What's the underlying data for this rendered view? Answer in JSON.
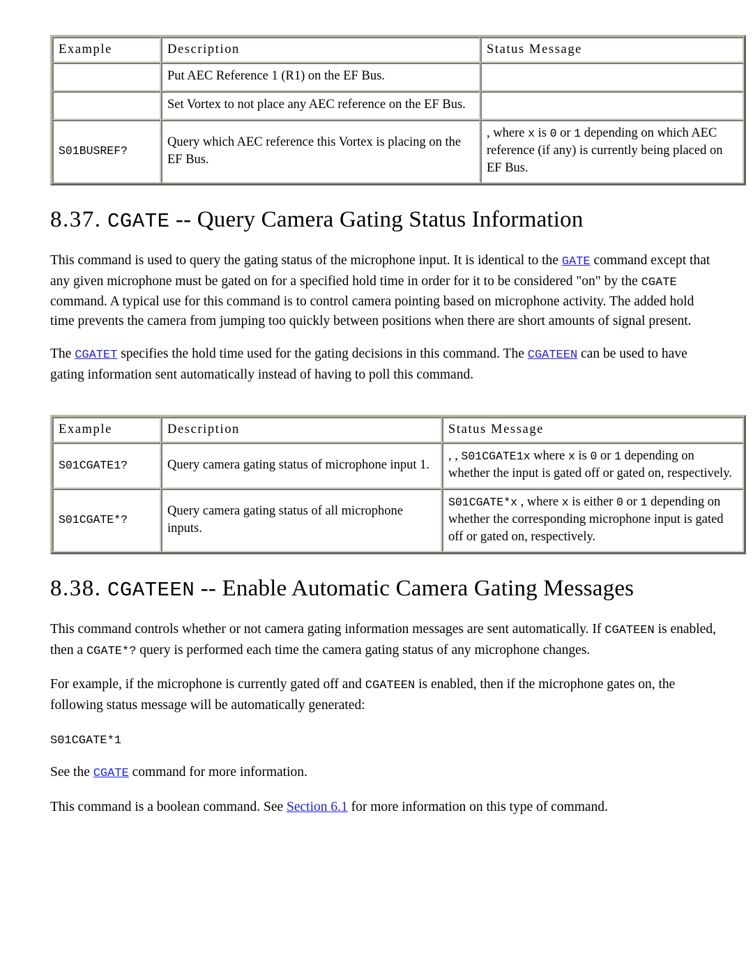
{
  "table_busref": {
    "headers": [
      "Example",
      "Description",
      "Status Message"
    ],
    "rows": [
      {
        "example": "",
        "description": "Put AEC Reference 1 (R1) on the EF Bus.",
        "status": ""
      },
      {
        "example": "",
        "description": "Set Vortex to not place any AEC reference on the EF Bus.",
        "status": ""
      },
      {
        "example": "S01BUSREF?",
        "description": "Query which AEC reference this Vortex is placing on the EF Bus.",
        "status_parts": {
          "lead": ", where ",
          "x": "x",
          "mid1": " is ",
          "zero": "0",
          "mid2": " or ",
          "one": "1",
          "tail": " depending on which AEC reference (if any) is currently being placed on EF Bus."
        }
      }
    ]
  },
  "section_cgate": {
    "number": "8.37.",
    "command": "CGATE",
    "dashes": "--",
    "title": "Query Camera Gating Status Information",
    "paragraph_1": {
      "part_1": "This command is used to query the gating status of the microphone input. It is identical to the ",
      "link_gate": "GATE",
      "part_2": " command except that any given microphone must be gated on for a specified hold time in order for it to be considered \"on\" by the ",
      "mono_cgate": "CGATE",
      "part_3": " command. A typical use for this command is to control camera pointing based on microphone activity. The added hold time prevents the camera from jumping too quickly between positions when there are short amounts of signal present."
    },
    "paragraph_2": {
      "part_1": "The ",
      "link_cgatet": "CGATET",
      "part_2": " specifies the hold time used for the gating decisions in this command. The ",
      "link_cgateen": "CGATEEN",
      "part_3": " can be used to have gating information sent automatically instead of having to poll this command."
    }
  },
  "table_cgate": {
    "headers": [
      "Example",
      "Description",
      "Status Message"
    ],
    "rows": [
      {
        "example": "S01CGATE1?",
        "description": "Query camera gating status of microphone input 1.",
        "status_parts": {
          "lead": ", , ",
          "code": "S01CGATE1x",
          "mid1": " where ",
          "x": "x",
          "mid2": " is ",
          "zero": "0",
          "mid3": " or ",
          "one": "1",
          "tail": " depending on whether the input is gated off or gated on, respectively."
        }
      },
      {
        "example": "S01CGATE*?",
        "description": "Query camera gating status of all microphone inputs.",
        "status_parts": {
          "lead": "",
          "code": "S01CGATE*x",
          "mid1": " , where ",
          "x": "x",
          "mid2": " is either ",
          "zero": "0",
          "mid3": " or ",
          "one": "1",
          "tail": " depending on whether the corresponding microphone input is gated off or gated on, respectively."
        }
      }
    ]
  },
  "section_cgateen": {
    "number": "8.38.",
    "command": "CGATEEN",
    "dashes": "--",
    "title": "Enable Automatic Camera Gating Messages",
    "paragraph_1": {
      "part_1": "This command controls whether or not camera gating information messages are sent automatically. If ",
      "mono_cgateen": "CGATEEN",
      "part_2": " is enabled, then a ",
      "mono_cgate_star": "CGATE*?",
      "part_3": " query is performed each time the camera gating status of any microphone changes."
    },
    "paragraph_2": {
      "part_1": "For example, if the microphone is currently gated off and ",
      "mono_cgateen": "CGATEEN",
      "part_2": " is enabled, then if the microphone gates on, the following status message will be automatically generated:"
    },
    "code_example": "S01CGATE*1",
    "paragraph_3": {
      "part_1": "See the ",
      "link_cgate": "CGATE",
      "part_2": " command for more information."
    },
    "paragraph_4": {
      "part_1": "This command is a boolean command. See ",
      "link_section": "Section 6.1",
      "part_2": " for more information on this type of command."
    }
  },
  "colors": {
    "link": "#2020e0",
    "text": "#000000",
    "table_border_outer": "#b8b8a8",
    "table_border_inner": "#cfcfc4",
    "background": "#ffffff"
  }
}
